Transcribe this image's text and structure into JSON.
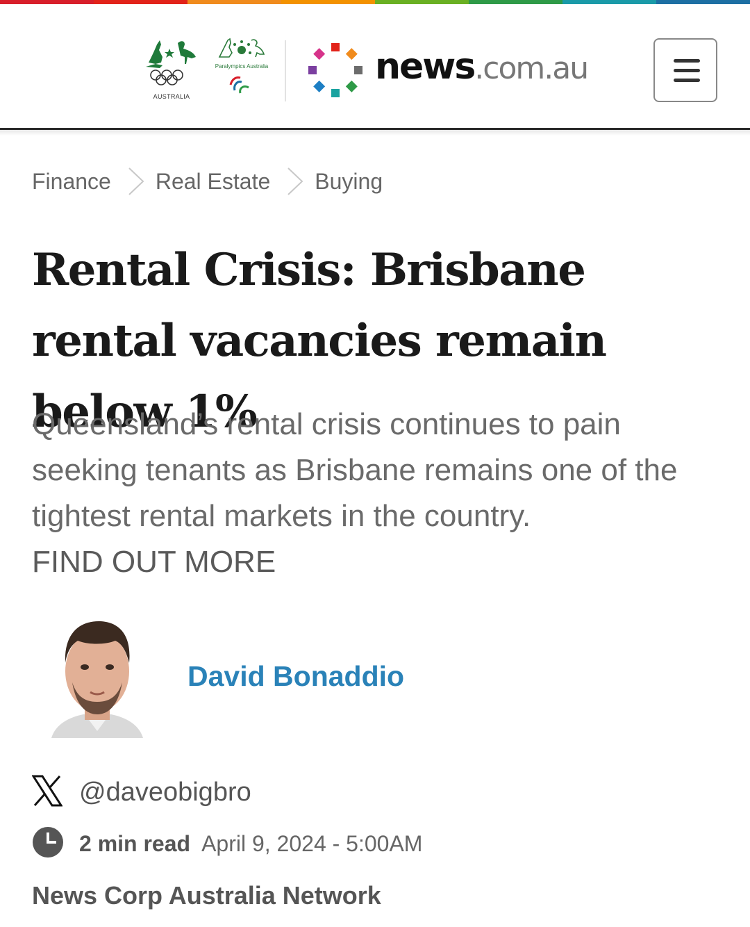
{
  "top_bar_colors": [
    "#d81e2a",
    "#e2231a",
    "#f08b1d",
    "#f39200",
    "#6ab023",
    "#2e9a47",
    "#1a9aa8",
    "#1d6fa3"
  ],
  "header": {
    "olympic_logo_caption": "AUSTRALIA",
    "paralympic_logo_caption": "Paralympics Australia",
    "brand_primary": "news",
    "brand_suffix": ".com.au",
    "menu_icon": "hamburger-menu-icon"
  },
  "breadcrumb": [
    {
      "label": "Finance"
    },
    {
      "label": "Real Estate"
    },
    {
      "label": "Buying"
    }
  ],
  "article": {
    "headline": "Rental Crisis: Brisbane rental vacancies remain below 1%",
    "standfirst": "Queensland’s rental crisis continues to pain seeking tenants as Brisbane remains one of the tightest rental markets in the country.",
    "find_out_more": "FIND OUT MORE",
    "author": "David Bonaddio",
    "social_handle": "@daveobigbro",
    "read_time": "2 min read",
    "published": "April 9, 2024 - 5:00AM",
    "network": "News Corp Australia Network"
  },
  "colors": {
    "author_link": "#2a82b8",
    "headline": "#1a1a1a",
    "brand_dots": [
      "#e2231a",
      "#f08b1d",
      "#6c6c6c",
      "#2e9a47",
      "#1aa3a0",
      "#1d7fc4",
      "#7b3fa0",
      "#d6338a"
    ]
  }
}
